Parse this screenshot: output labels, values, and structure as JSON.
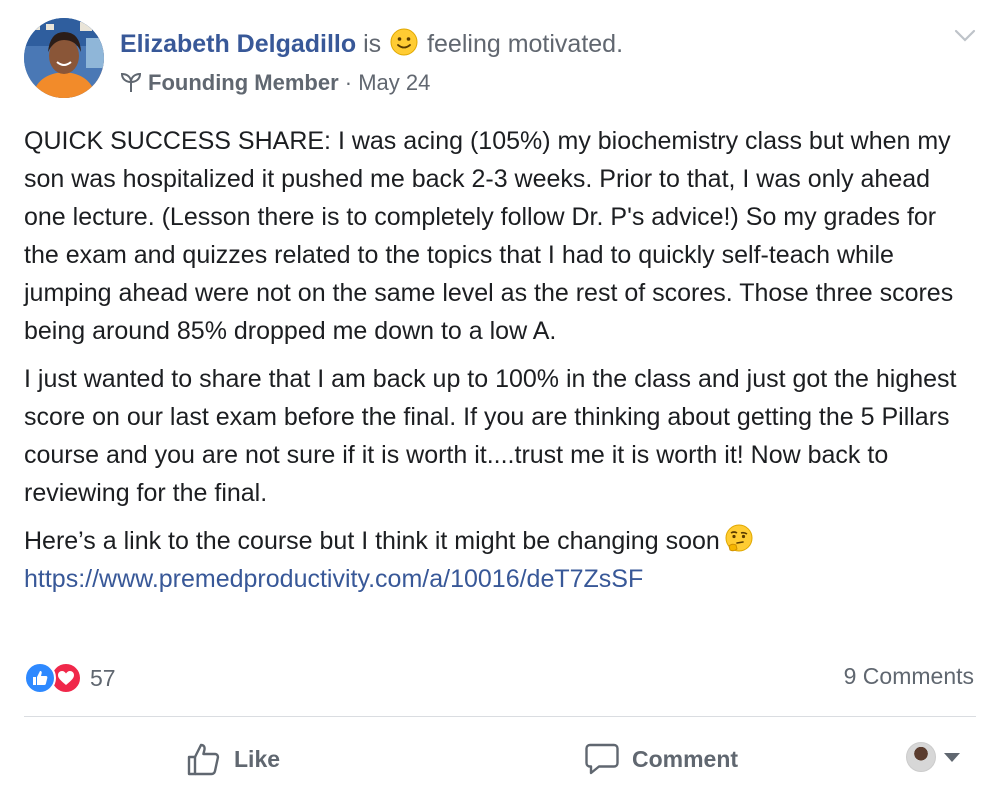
{
  "header": {
    "author": "Elizabeth Delgadillo",
    "is_text": "is",
    "feeling": "feeling motivated.",
    "role": "Founding Member",
    "separator": "·",
    "date": "May 24"
  },
  "body": {
    "paragraphs": [
      "QUICK SUCCESS SHARE: I was acing (105%) my biochemistry class but when my son was hospitalized it pushed me back 2-3 weeks. Prior to that, I was only ahead one lecture. (Lesson there is to completely follow Dr. P's advice!) So my grades for the exam and quizzes related to the topics that I had to quickly self-teach while jumping ahead were not on the same level as the rest of scores. Those three scores being around 85% dropped me down to a low A.",
      "I just wanted to share that I am back up to 100% in the class and just got the highest score on our last exam before the final. If you are thinking about getting the 5 Pillars course and you are not sure if it is worth it....trust me it is worth it! Now back to reviewing for the final."
    ],
    "link_intro": "Here’s a link to the course but I think it might be changing soon",
    "link": "https://www.premedproductivity.com/a/10016/deT7ZsSF"
  },
  "stats": {
    "reaction_count": "57",
    "comments": "9 Comments"
  },
  "actions": {
    "like": "Like",
    "comment": "Comment"
  },
  "icons": {
    "feeling": "slightly-smiling-emoji-icon",
    "role": "sprout-icon",
    "menu": "chevron-down-icon",
    "thinking": "thinking-face-emoji-icon",
    "like_reaction": "thumbs-up-icon",
    "love_reaction": "heart-icon"
  },
  "colors": {
    "link": "#385898",
    "secondary_text": "#606770",
    "like_blue": "#2e89ff",
    "love_red": "#f0284a"
  }
}
